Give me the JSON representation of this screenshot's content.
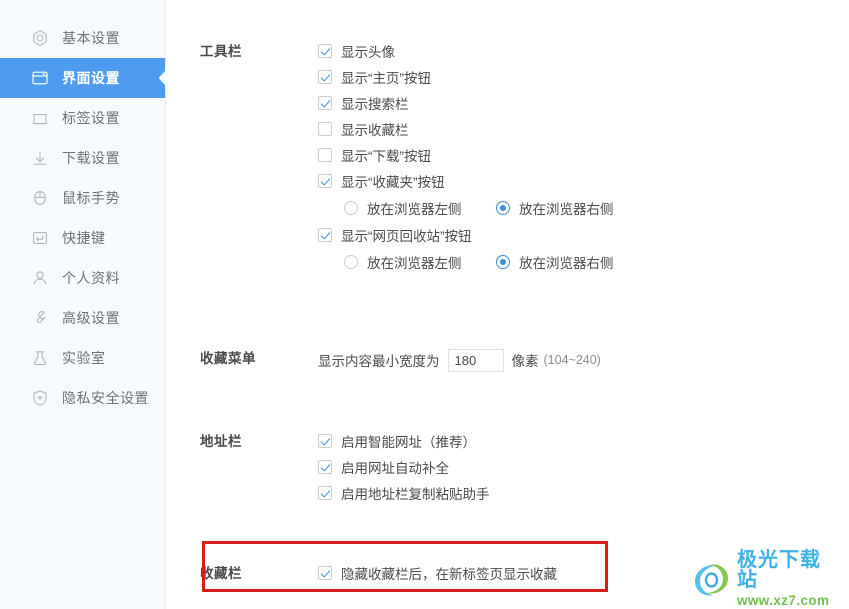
{
  "sidebar": {
    "items": [
      {
        "label": "基本设置",
        "icon": "hexagon-gear-icon",
        "active": false
      },
      {
        "label": "界面设置",
        "icon": "browser-window-icon",
        "active": true
      },
      {
        "label": "标签设置",
        "icon": "tab-icon",
        "active": false
      },
      {
        "label": "下载设置",
        "icon": "download-arrow-icon",
        "active": false
      },
      {
        "label": "鼠标手势",
        "icon": "mouse-icon",
        "active": false
      },
      {
        "label": "快捷键",
        "icon": "keyboard-key-icon",
        "active": false
      },
      {
        "label": "个人资料",
        "icon": "person-icon",
        "active": false
      },
      {
        "label": "高级设置",
        "icon": "wrench-icon",
        "active": false
      },
      {
        "label": "实验室",
        "icon": "flask-icon",
        "active": false
      },
      {
        "label": "隐私安全设置",
        "icon": "shield-plus-icon",
        "active": false
      }
    ]
  },
  "sections": {
    "toolbar": {
      "label": "工具栏",
      "checkboxes": [
        {
          "label": "显示头像",
          "checked": true
        },
        {
          "label": "显示“主页”按钮",
          "checked": true
        },
        {
          "label": "显示搜索栏",
          "checked": true
        },
        {
          "label": "显示收藏栏",
          "checked": false
        },
        {
          "label": "显示“下载”按钮",
          "checked": false
        },
        {
          "label": "显示“收藏夹”按钮",
          "checked": true
        }
      ],
      "favorites_position": {
        "left_label": "放在浏览器左侧",
        "right_label": "放在浏览器右侧",
        "selected": "right"
      },
      "recycle_checkbox": {
        "label": "显示“网页回收站”按钮",
        "checked": true
      },
      "recycle_position": {
        "left_label": "放在浏览器左侧",
        "right_label": "放在浏览器右侧",
        "selected": "right"
      }
    },
    "favorites_menu": {
      "label": "收藏菜单",
      "prefix": "显示内容最小宽度为",
      "value": "180",
      "unit": "像素",
      "range_hint": "(104~240)"
    },
    "address_bar": {
      "label": "地址栏",
      "checkboxes": [
        {
          "label": "启用智能网址（推荐）",
          "checked": true
        },
        {
          "label": "启用网址自动补全",
          "checked": true
        },
        {
          "label": "启用地址栏复制粘贴助手",
          "checked": true
        }
      ]
    },
    "favorites_bar": {
      "label": "收藏栏",
      "checkbox": {
        "label": "隐藏收藏栏后，在新标签页显示收藏",
        "checked": true
      },
      "highlighted": true
    }
  },
  "watermark": {
    "title": "极光下载站",
    "url": "www.xz7.com"
  },
  "colors": {
    "accent": "#4f9bf0",
    "check": "#3b8fe3",
    "highlight": "#d61e1e",
    "sidebar_bg": "#f7fafd",
    "text": "#4a4a4a"
  }
}
